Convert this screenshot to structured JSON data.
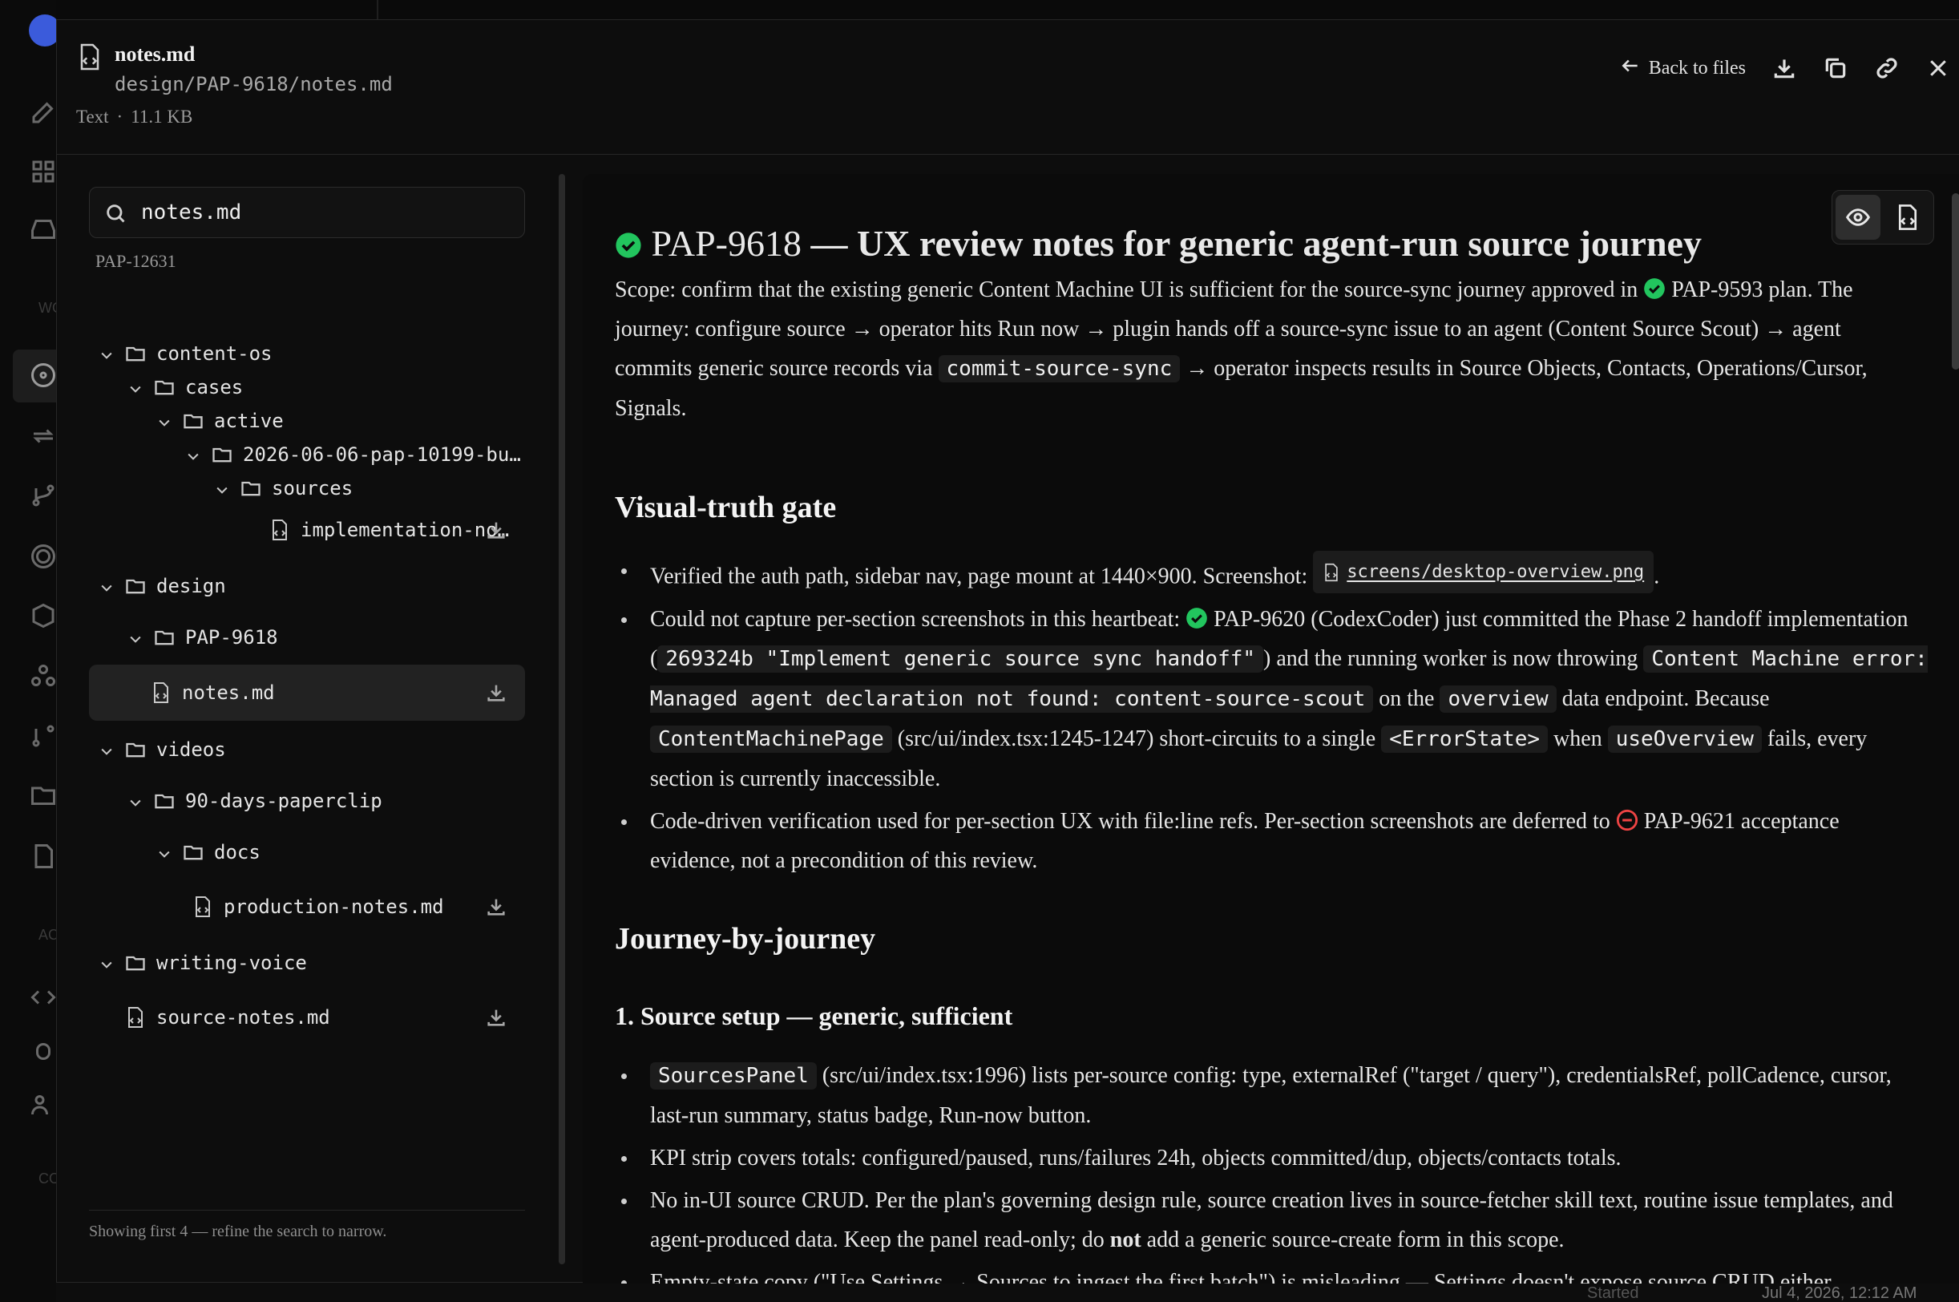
{
  "background_app": {
    "footer_label": "Started",
    "footer_date": "Jul 4, 2026, 12:12 AM",
    "rail_section_labels": [
      "WO",
      "AC",
      "CO"
    ],
    "rail_icons": [
      "paperclip-logo-icon",
      "edit-icon",
      "grid-icon",
      "inbox-icon",
      "target-icon",
      "repeat-icon",
      "git-branch-icon",
      "goal-icon",
      "package-icon",
      "component-icon",
      "git-fork-icon",
      "folder-icon",
      "document-icon",
      "code-icon",
      "bug-icon",
      "users-icon"
    ]
  },
  "header": {
    "file_name": "notes.md",
    "file_path": "design/PAP-9618/notes.md",
    "file_type": "Text",
    "meta_separator": "·",
    "file_size": "11.1 KB",
    "back_label": "Back to files"
  },
  "tree": {
    "search_value": "notes.md",
    "root_label": "PAP-12631",
    "footer": "Showing first 4 — refine the search to narrow.",
    "rows": [
      {
        "label": "content-os",
        "kind": "folder"
      },
      {
        "label": "cases",
        "kind": "folder"
      },
      {
        "label": "active",
        "kind": "folder"
      },
      {
        "label": "2026-06-06-pap-10199-bu…",
        "kind": "folder"
      },
      {
        "label": "sources",
        "kind": "folder"
      },
      {
        "label": "implementation-no…",
        "kind": "file"
      },
      {
        "label": "design",
        "kind": "folder"
      },
      {
        "label": "PAP-9618",
        "kind": "folder"
      },
      {
        "label": "notes.md",
        "kind": "file"
      },
      {
        "label": "videos",
        "kind": "folder"
      },
      {
        "label": "90-days-paperclip",
        "kind": "folder"
      },
      {
        "label": "docs",
        "kind": "folder"
      },
      {
        "label": "production-notes.md",
        "kind": "file"
      },
      {
        "label": "writing-voice",
        "kind": "folder"
      },
      {
        "label": "source-notes.md",
        "kind": "file"
      }
    ]
  },
  "doc": {
    "title_link": "PAP-9618",
    "title_rest": " — UX review notes for generic agent-run source journey",
    "scope": {
      "t1": "Scope: confirm that the existing generic Content Machine UI is sufficient for the source-sync journey approved in ",
      "link": "PAP-9593 plan",
      "t2": ". The journey: configure source → operator hits Run now → plugin hands off a source-sync issue to an agent (Content Source Scout) → agent commits generic source records via ",
      "code": "commit-source-sync",
      "t3": " → operator inspects results in Source Objects, Contacts, Operations/Cursor, Signals."
    },
    "h_visual": "Visual-truth gate",
    "visual": {
      "b1_text": "Verified the auth path, sidebar nav, page mount at 1440×900. Screenshot: ",
      "b1_file": "screens/desktop-overview.png",
      "b1_end": ".",
      "b2_t1": "Could not capture per-section screenshots in this heartbeat: ",
      "b2_link": "PAP-9620",
      "b2_t2": " (CodexCoder) just committed the Phase 2 handoff implementation (",
      "b2_code1": "269324b \"Implement generic source sync handoff\"",
      "b2_t3": ") and the running worker is now throwing ",
      "b2_code2": "Content Machine error: Managed agent declaration not found: content-source-scout",
      "b2_t4": " on the ",
      "b2_code3": "overview",
      "b2_t5": " data endpoint. Because ",
      "b2_code4": "ContentMachinePage",
      "b2_t6": " (src/ui/index.tsx:1245-1247) short-circuits to a single ",
      "b2_code5": "<ErrorState>",
      "b2_t7": " when ",
      "b2_code6": "useOverview",
      "b2_t8": " fails, every section is currently inaccessible.",
      "b3_t1": "Code-driven verification used for per-section UX with file:line refs. Per-section screenshots are deferred to ",
      "b3_link": "PAP-9621",
      "b3_t2": " acceptance evidence, not a precondition of this review."
    },
    "h_journey": "Journey-by-journey",
    "h_setup": "1. Source setup — generic, sufficient",
    "setup": {
      "b1_code": "SourcesPanel",
      "b1_text": " (src/ui/index.tsx:1996) lists per-source config: type, externalRef (\"target / query\"), credentialsRef, pollCadence, cursor, last-run summary, status badge, Run-now button.",
      "b2_text": "KPI strip covers totals: configured/paused, runs/failures 24h, objects committed/dup, objects/contacts totals.",
      "b3_t1": "No in-UI source CRUD. Per the plan's governing design rule, source creation lives in source-fetcher skill text, routine issue templates, and agent-produced data. Keep the panel read-only; do ",
      "b3_bold": "not",
      "b3_t2": " add a generic source-create form in this scope.",
      "b4_text": "Empty-state copy (\"Use Settings → Sources to ingest the first batch\") is misleading — Settings doesn't expose source CRUD either."
    },
    "colors": {
      "ok": "#22c55e",
      "blocked": "#ef4444"
    }
  }
}
